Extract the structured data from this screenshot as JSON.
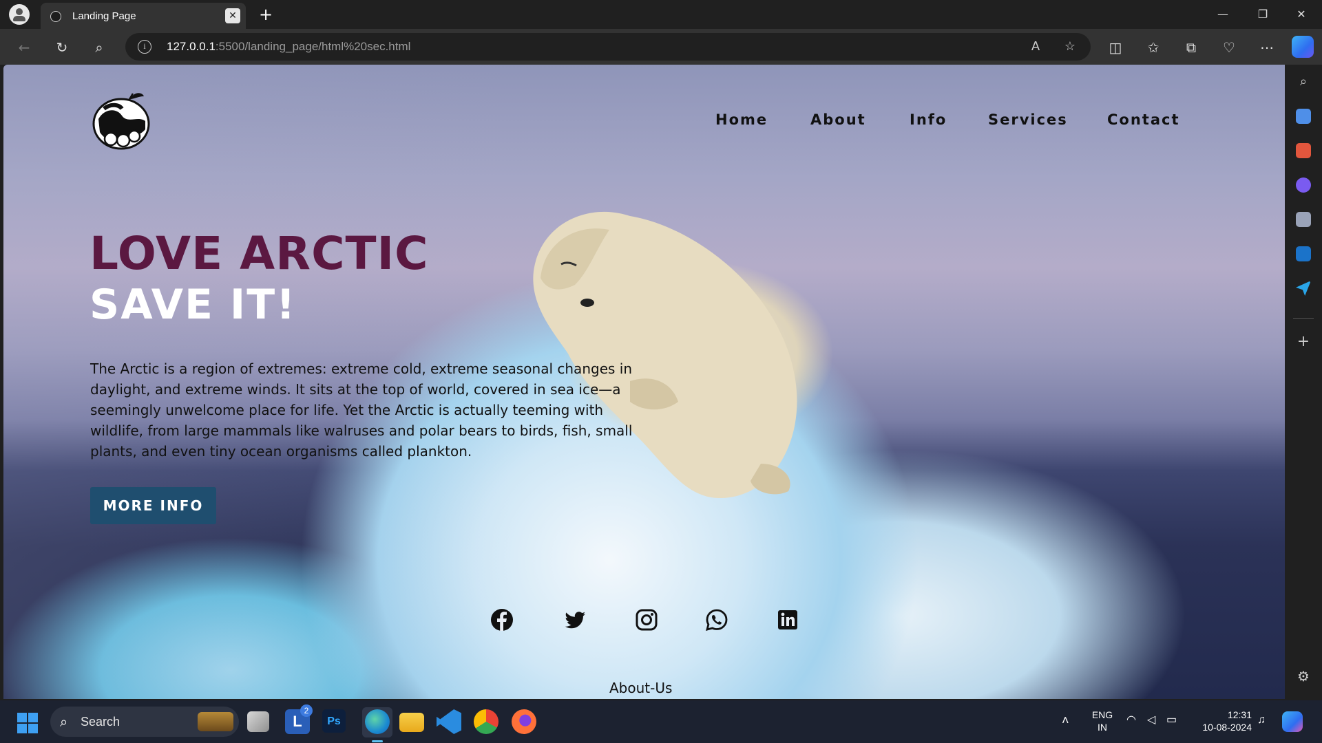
{
  "browser": {
    "tab_title": "Landing Page",
    "url_host": "127.0.0.1",
    "url_rest": ":5500/landing_page/html%20sec.html"
  },
  "page": {
    "nav": [
      "Home",
      "About",
      "Info",
      "Services",
      "Contact"
    ],
    "headline_line1": "LOVE ARCTIC",
    "headline_line2": "SAVE IT!",
    "body": "The Arctic is a region of extremes: extreme cold, extreme seasonal changes in daylight, and extreme winds. It sits at the top of world, covered in sea ice—a seemingly unwelcome place for life. Yet the Arctic is actually teeming with wildlife, from large mammals like walruses and polar bears to birds, fish, small plants, and even tiny ocean organisms called plankton.",
    "cta_label": "MORE INFO",
    "social_icons": [
      "facebook-icon",
      "twitter-icon",
      "instagram-icon",
      "whatsapp-icon",
      "linkedin-icon"
    ],
    "footer_link": "About-Us",
    "colors": {
      "headline_accent": "#5b1841",
      "cta_bg": "#1f4e6f"
    }
  },
  "taskbar": {
    "search_label": "Search",
    "lang_line1": "ENG",
    "lang_line2": "IN",
    "time": "12:31",
    "date": "10-08-2024",
    "badge_count": "2"
  }
}
